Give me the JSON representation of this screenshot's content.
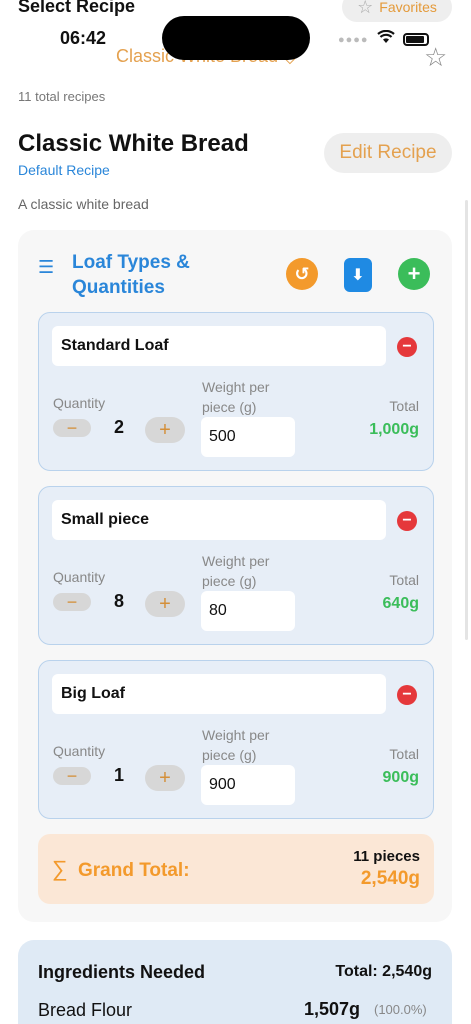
{
  "status": {
    "time": "06:42"
  },
  "header": {
    "title": "Select Recipe",
    "favorites_label": "Favorites",
    "recipe_switch": "Classic White Bread ◇"
  },
  "recipe": {
    "count_text": "11 total recipes",
    "title": "Classic White Bread",
    "subtitle": "Default Recipe",
    "description": "A classic white bread",
    "edit_label": "Edit Recipe"
  },
  "loaf_panel": {
    "title": "Loaf Types & Quantities",
    "labels": {
      "quantity": "Quantity",
      "weight": "Weight per piece (g)",
      "total": "Total"
    },
    "loaves": [
      {
        "name": "Standard Loaf",
        "quantity": "2",
        "weight": "500",
        "total": "1,000g"
      },
      {
        "name": "Small piece",
        "quantity": "8",
        "weight": "80",
        "total": "640g"
      },
      {
        "name": "Big Loaf",
        "quantity": "1",
        "weight": "900",
        "total": "900g"
      }
    ],
    "grand_total": {
      "label": "Grand Total:",
      "pieces": "11 pieces",
      "weight": "2,540g"
    }
  },
  "ingredients": {
    "title": "Ingredients Needed",
    "total": "Total: 2,540g",
    "items": [
      {
        "name": "Bread Flour",
        "amount": "1,507g",
        "percent": "(100.0%)"
      }
    ]
  },
  "colors": {
    "accent_orange": "#f39a2c",
    "accent_blue": "#2a86d9",
    "accent_green": "#3bbd5a",
    "danger_red": "#e5383b"
  },
  "icons": [
    "star-icon",
    "wifi-icon",
    "battery-icon",
    "list-icon",
    "reset-icon",
    "download-icon",
    "add-icon",
    "remove-icon",
    "sigma-icon"
  ]
}
